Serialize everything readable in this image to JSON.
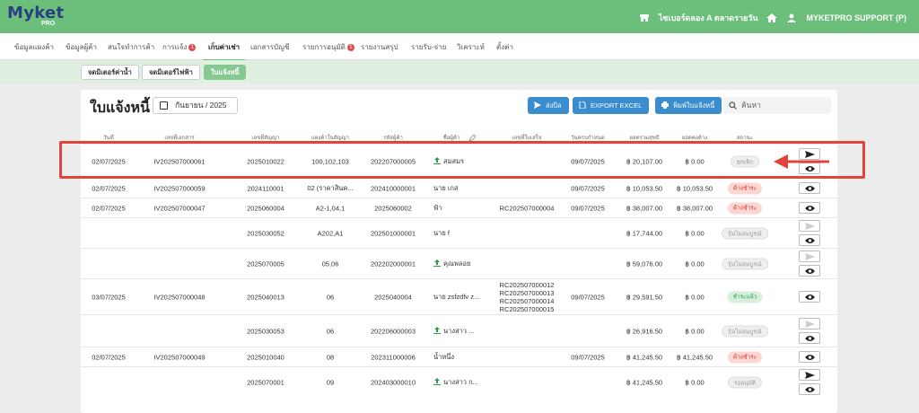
{
  "app": {
    "logo": "Myket",
    "logo_sub": "PRO"
  },
  "topbar": {
    "store": "ไซเบอร์ดลอง A ตลาดรายวัน",
    "user": "MYKETPRO SUPPORT (P)"
  },
  "menu": [
    {
      "label": "ข้อมูลแผงค้า",
      "badge": ""
    },
    {
      "label": "ข้อมูลผู้ค้า",
      "badge": ""
    },
    {
      "label": "สนใจทำการค้า",
      "badge": ""
    },
    {
      "label": "การแจ้ง",
      "badge": "1"
    },
    {
      "label": "เก็บค่าเช่า",
      "badge": ""
    },
    {
      "label": "เอกสารบัญชี",
      "badge": ""
    },
    {
      "label": "รายการอนุมัติ",
      "badge": "1"
    },
    {
      "label": "รายงานสรุป",
      "badge": ""
    },
    {
      "label": "รายรับ-จ่าย",
      "badge": ""
    },
    {
      "label": "วิเคราะห์",
      "badge": ""
    },
    {
      "label": "ตั้งค่า",
      "badge": ""
    }
  ],
  "subtabs": [
    "จดมิเตอร์ค่าน้ำ",
    "จดมิเตอร์ไฟฟ้า",
    "ใบแจ้งหนี้"
  ],
  "page": {
    "title": "ใบแจ้งหนี้",
    "month": "กันยายน / 2025",
    "btn_send": "ส่งบิล",
    "btn_export": "EXPORT EXCEL",
    "btn_print": "พิมพ์ใบแจ้งหนี้",
    "search_placeholder": "ค้นหา"
  },
  "columns": [
    "วันที่",
    "เลขที่เอกสาร",
    "เลขที่สัญญา",
    "แผงค้าในสัญญา",
    "รหัสผู้ค้า",
    "ชื่อผู้ค้า",
    "เลขที่ใบเสร็จ",
    "วันครบกำหนด",
    "ยอดรวมสุทธิ",
    "ยอดคงค้าง",
    "สถานะ"
  ],
  "rows": [
    {
      "date": "02/07/2025",
      "doc": "IV202507000061",
      "contract": "2025010022",
      "stalls": "100,102,103",
      "merchant_id": "202207000005",
      "name": "สมสมร",
      "name_icon": true,
      "receipt": "",
      "due": "09/07/2025",
      "total": "฿ 20,107.00",
      "balance": "฿ 0.00",
      "status": "ยกเลิก",
      "status_type": "cancel",
      "send_enabled": true
    },
    {
      "date": "02/07/2025",
      "doc": "IV202507000059",
      "contract": "2024110001",
      "stalls": "02 (ราคาสินค...",
      "merchant_id": "202410000001",
      "name": "นาย เกส",
      "name_icon": false,
      "receipt": "",
      "due": "09/07/2025",
      "total": "฿ 10,053.50",
      "balance": "฿ 10,053.50",
      "status": "ค้างชำระ",
      "status_type": "unpaid",
      "send_enabled": null
    },
    {
      "date": "02/07/2025",
      "doc": "IV202507000047",
      "contract": "2025060004",
      "stalls": "A2-1,04,1",
      "merchant_id": "2025060002",
      "name": "ฟ้า",
      "name_icon": false,
      "receipt": "RC202507000004",
      "due": "09/07/2025",
      "total": "฿ 38,007.00",
      "balance": "฿ 38,007.00",
      "status": "ค้างชำระ",
      "status_type": "unpaid",
      "send_enabled": null
    },
    {
      "date": "",
      "doc": "",
      "contract": "2025030052",
      "stalls": "A202,A1",
      "merchant_id": "202501000001",
      "name": "นาย f",
      "name_icon": false,
      "receipt": "",
      "due": "",
      "total": "฿ 17,744.00",
      "balance": "฿ 0.00",
      "status": "บิลไม่สมบูรณ์",
      "status_type": "incomplete",
      "send_enabled": false
    },
    {
      "date": "",
      "doc": "",
      "contract": "2025070005",
      "stalls": "05,06",
      "merchant_id": "202202000001",
      "name": "คุณพลอย",
      "name_icon": true,
      "receipt": "",
      "due": "",
      "total": "฿ 59,076.00",
      "balance": "฿ 0.00",
      "status": "บิลไม่สมบูรณ์",
      "status_type": "incomplete",
      "send_enabled": false
    },
    {
      "date": "03/07/2025",
      "doc": "IV202507000048",
      "contract": "2025040013",
      "stalls": "06",
      "merchant_id": "2025040004",
      "name": "นาย zsfzdfv z...",
      "name_icon": false,
      "receipt": "RC202507000012\nRC202507000013\nRC202507000014\nRC202507000015",
      "due": "09/07/2025",
      "total": "฿ 29,591.50",
      "balance": "฿ 0.00",
      "status": "ชำระแล้ว",
      "status_type": "paid",
      "send_enabled": null
    },
    {
      "date": "",
      "doc": "",
      "contract": "2025030053",
      "stalls": "06",
      "merchant_id": "202206000003",
      "name": "นางสาว ...",
      "name_icon": true,
      "receipt": "",
      "due": "",
      "total": "฿ 26,916.50",
      "balance": "฿ 0.00",
      "status": "บิลไม่สมบูรณ์",
      "status_type": "incomplete",
      "send_enabled": false
    },
    {
      "date": "02/07/2025",
      "doc": "IV202507000049",
      "contract": "2025010040",
      "stalls": "08",
      "merchant_id": "202311000006",
      "name": "น้ำหนึ่ง",
      "name_icon": false,
      "receipt": "",
      "due": "09/07/2025",
      "total": "฿ 41,245.50",
      "balance": "฿ 41,245.50",
      "status": "ค้างชำระ",
      "status_type": "unpaid",
      "send_enabled": null
    },
    {
      "date": "",
      "doc": "",
      "contract": "2025070001",
      "stalls": "09",
      "merchant_id": "202403000010",
      "name": "นางสาว ก...",
      "name_icon": true,
      "receipt": "",
      "due": "",
      "total": "฿ 41,245.50",
      "balance": "฿ 0.00",
      "status": "รออนุมัติ",
      "status_type": "waiting",
      "send_enabled": true
    }
  ],
  "colors": {
    "brand_green": "#6bbf7b",
    "logo_blue": "#2a3f80",
    "button_blue": "#3a8ed0",
    "highlight_red": "#e0443a"
  }
}
